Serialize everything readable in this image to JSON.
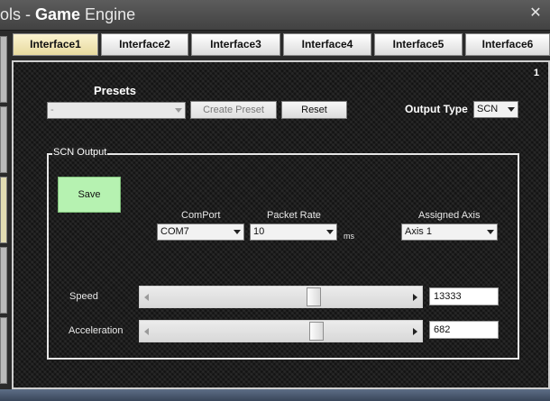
{
  "window": {
    "title_prefix": "ols - ",
    "title_bold": "Game",
    "title_suffix": " Engine",
    "close_label": "✕"
  },
  "tabs": [
    "Interface1",
    "Interface2",
    "Interface3",
    "Interface4",
    "Interface5",
    "Interface6"
  ],
  "active_tab": "Interface1",
  "panel": {
    "number": "1"
  },
  "presets": {
    "title": "Presets",
    "selected": "-",
    "create_label": "Create Preset",
    "reset_label": "Reset"
  },
  "output_type": {
    "label": "Output Type",
    "selected": "SCN"
  },
  "scn_output": {
    "group_title": "SCN Output",
    "save_label": "Save",
    "comport": {
      "label": "ComPort",
      "selected": "COM7"
    },
    "packet_rate": {
      "label": "Packet Rate",
      "selected": "10",
      "unit": "ms"
    },
    "assigned_axis": {
      "label": "Assigned Axis",
      "selected": "Axis 1"
    },
    "speed": {
      "label": "Speed",
      "value": "13333",
      "slider_fraction": 0.63
    },
    "acceleration": {
      "label": "Acceleration",
      "value": "682",
      "slider_fraction": 0.64
    }
  },
  "icons": {
    "close": "close-icon",
    "dropdown": "chevron-down-icon",
    "slider_left": "arrow-left-icon",
    "slider_right": "arrow-right-icon"
  }
}
